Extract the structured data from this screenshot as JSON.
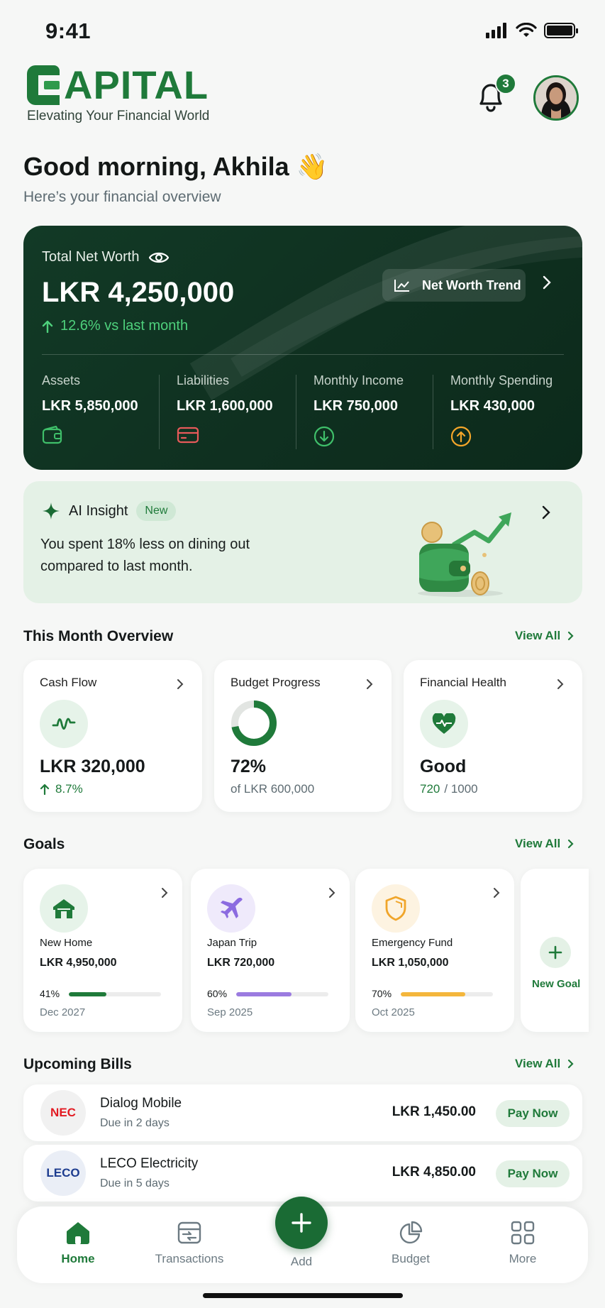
{
  "status_bar": {
    "time": "9:41"
  },
  "header": {
    "logo_text": "APITAL",
    "tagline": "Elevating Your Financial World",
    "notification_count": "3"
  },
  "greeting": {
    "title": "Good morning, Akhila 👋",
    "subtitle": "Here’s your financial overview"
  },
  "net_worth": {
    "title": "Total Net Worth",
    "amount": "LKR 4,250,000",
    "change": "12.6% vs last month",
    "trend_button": "Net Worth Trend",
    "stats": [
      {
        "label": "Assets",
        "value": "LKR 5,850,000",
        "icon": "wallet-icon"
      },
      {
        "label": "Liabilities",
        "value": "LKR 1,600,000",
        "icon": "credit-card-icon"
      },
      {
        "label": "Monthly Income",
        "value": "LKR 750,000",
        "icon": "arrow-down-circle-icon"
      },
      {
        "label": "Monthly Spending",
        "value": "LKR 430,000",
        "icon": "arrow-up-circle-icon"
      }
    ]
  },
  "ai_insight": {
    "title": "AI Insight",
    "badge": "New",
    "text": "You spent 18% less on dining out compared to last month."
  },
  "overview": {
    "title": "This Month Overview",
    "view_all": "View All",
    "cards": [
      {
        "label": "Cash Flow",
        "value": "LKR 320,000",
        "sub": "8.7%"
      },
      {
        "label": "Budget Progress",
        "value": "72%",
        "sub": "of LKR 600,000",
        "progress": 0.72
      },
      {
        "label": "Financial Health",
        "value": "Good",
        "score": "720",
        "score_total": "/ 1000"
      }
    ]
  },
  "goals": {
    "title": "Goals",
    "view_all": "View All",
    "items": [
      {
        "name": "New Home",
        "amount": "LKR 4,950,000",
        "percent": "41%",
        "progress": 0.41,
        "date": "Dec 2027",
        "color": "#1f7a3a",
        "icon": "house-icon"
      },
      {
        "name": "Japan Trip",
        "amount": "LKR 720,000",
        "percent": "60%",
        "progress": 0.6,
        "date": "Sep 2025",
        "color": "#9b7be0",
        "icon": "airplane-icon"
      },
      {
        "name": "Emergency Fund",
        "amount": "LKR 1,050,000",
        "percent": "70%",
        "progress": 0.7,
        "date": "Oct 2025",
        "color": "#f4b63c",
        "icon": "shield-icon"
      }
    ],
    "new_goal": "New Goal"
  },
  "bills": {
    "title": "Upcoming Bills",
    "view_all": "View All",
    "items": [
      {
        "logo": "NEC",
        "name": "Dialog Mobile",
        "due": "Due in 2 days",
        "amount": "LKR 1,450.00",
        "action": "Pay Now"
      },
      {
        "logo": "LECO",
        "name": "LECO Electricity",
        "due": "Due in 5 days",
        "amount": "LKR 4,850.00",
        "action": "Pay Now"
      }
    ]
  },
  "bottom_nav": {
    "items": [
      {
        "label": "Home",
        "icon": "home-icon"
      },
      {
        "label": "Transactions",
        "icon": "transactions-icon"
      },
      {
        "label": "Add",
        "icon": "plus-icon"
      },
      {
        "label": "Budget",
        "icon": "pie-chart-icon"
      },
      {
        "label": "More",
        "icon": "grid-icon"
      }
    ]
  },
  "colors": {
    "brand": "#1f7a3a",
    "card_dark": "#0f3020",
    "positive": "#4ed07c",
    "liability": "#e85a5a",
    "spending": "#f4a62a"
  }
}
